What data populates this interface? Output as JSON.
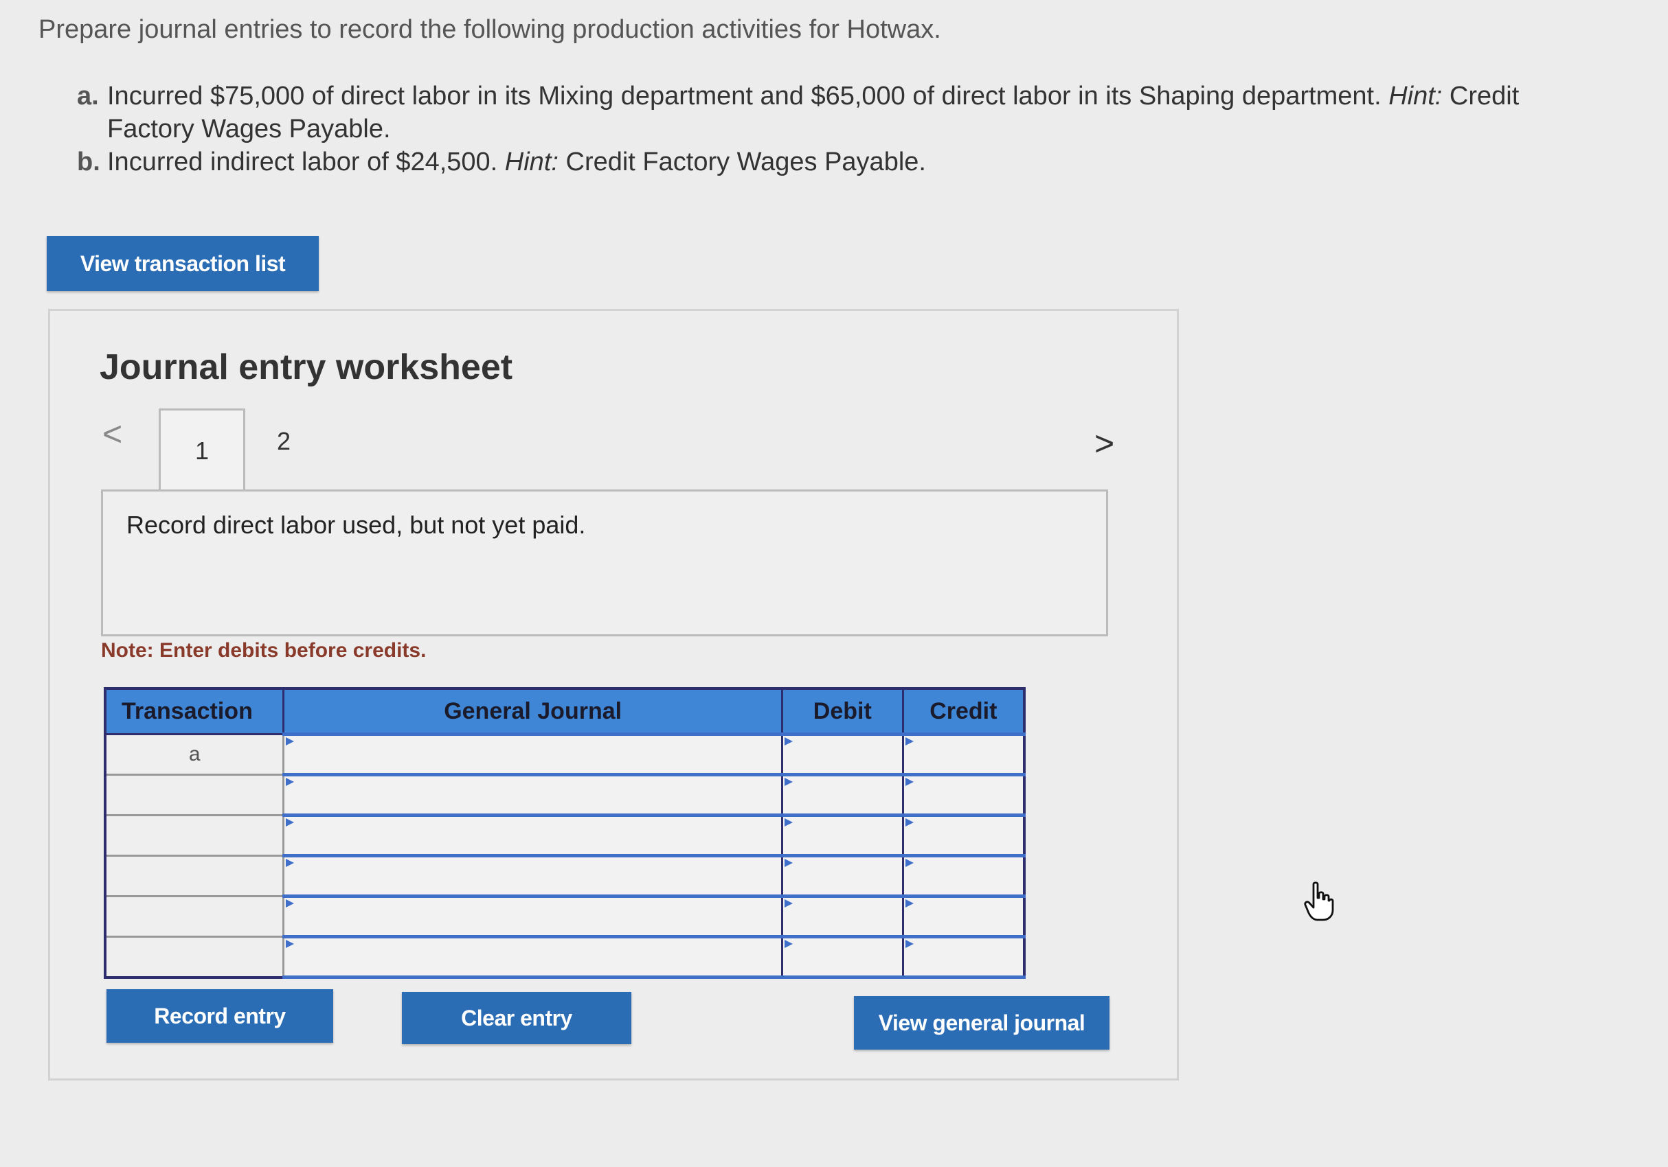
{
  "prompt": "Prepare journal entries to record the following production activities for Hotwax.",
  "items": [
    {
      "letter": "a.",
      "text": "Incurred $75,000 of direct labor in its Mixing department and $65,000 of direct labor in its Shaping department. ",
      "hint_label": "Hint:",
      "hint_text": " Credit Factory Wages Payable."
    },
    {
      "letter": "b.",
      "text": "Incurred indirect labor of $24,500. ",
      "hint_label": "Hint:",
      "hint_text": " Credit Factory Wages Payable."
    }
  ],
  "buttons": {
    "view_transaction_list": "View transaction list",
    "record_entry": "Record entry",
    "clear_entry": "Clear entry",
    "view_general_journal": "View general journal"
  },
  "worksheet": {
    "title": "Journal entry worksheet",
    "nav_prev": "<",
    "nav_next": ">",
    "tabs": [
      "1",
      "2"
    ],
    "active_tab": "1",
    "description": "Record direct labor used, but not yet paid.",
    "note": "Note: Enter debits before credits."
  },
  "table": {
    "headers": [
      "Transaction",
      "General Journal",
      "Debit",
      "Credit"
    ],
    "rows": [
      {
        "transaction": "a",
        "account": "",
        "debit": "",
        "credit": ""
      },
      {
        "transaction": "",
        "account": "",
        "debit": "",
        "credit": ""
      },
      {
        "transaction": "",
        "account": "",
        "debit": "",
        "credit": ""
      },
      {
        "transaction": "",
        "account": "",
        "debit": "",
        "credit": ""
      },
      {
        "transaction": "",
        "account": "",
        "debit": "",
        "credit": ""
      },
      {
        "transaction": "",
        "account": "",
        "debit": "",
        "credit": ""
      }
    ]
  },
  "colors": {
    "button_blue": "#2a6db5",
    "header_blue": "#3f86d6",
    "note_red": "#8a3a2a"
  },
  "icons": {
    "cursor": "hand-pointer-icon"
  }
}
